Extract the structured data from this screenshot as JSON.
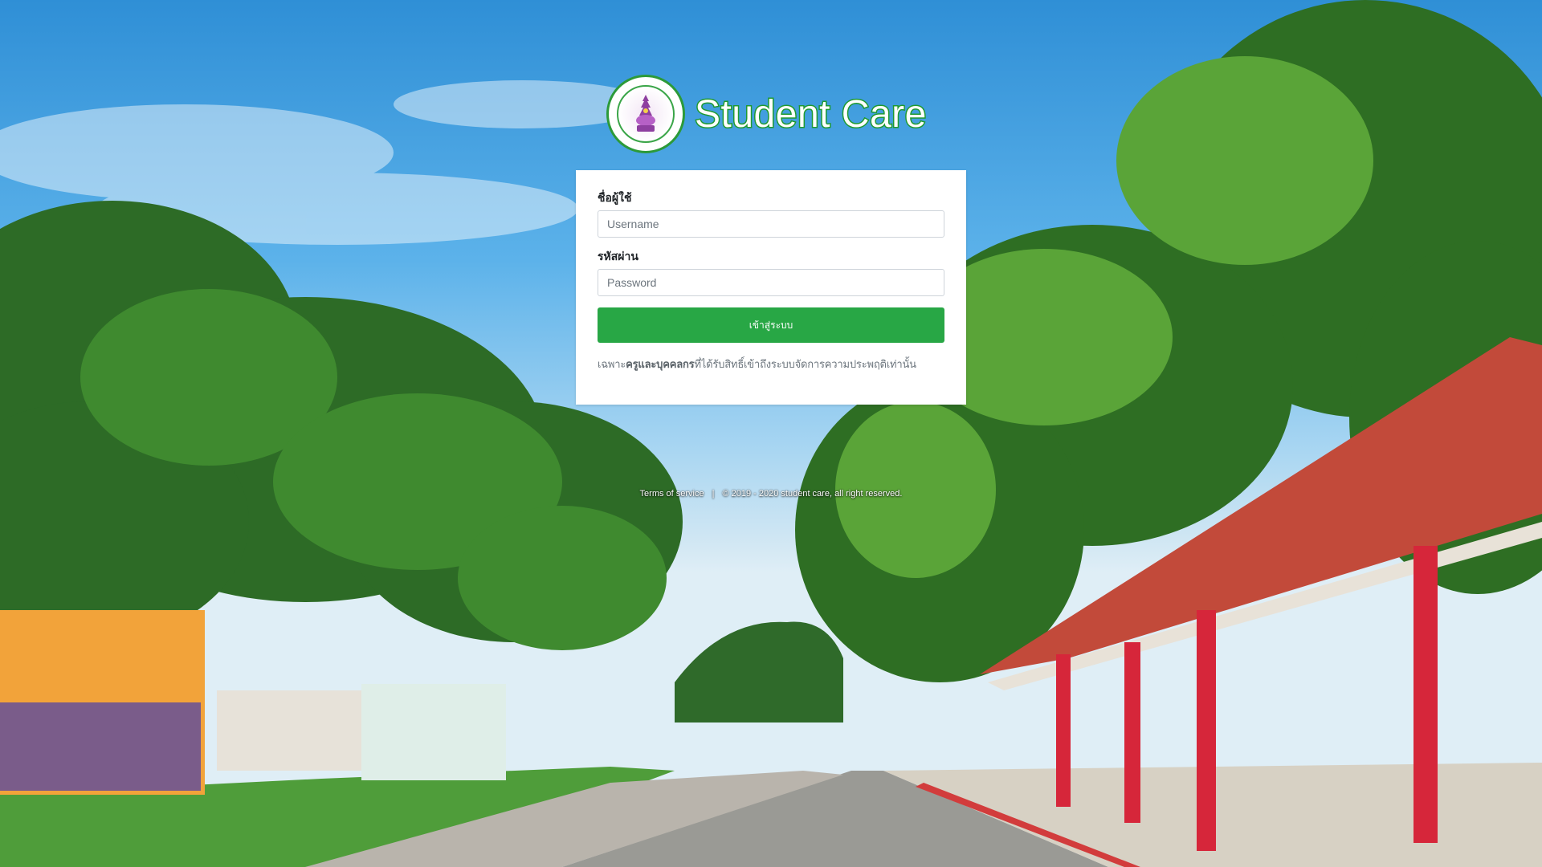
{
  "app": {
    "title": "Student Care",
    "seal_icon": "school-seal-icon"
  },
  "login_form": {
    "username_label": "ชื่อผู้ใช้",
    "username_placeholder": "Username",
    "username_value": "",
    "password_label": "รหัสผ่าน",
    "password_placeholder": "Password",
    "password_value": "",
    "submit_label": "เข้าสู่ระบบ",
    "notice_prefix": "เฉพาะ",
    "notice_emphasis": "ครูและบุคคลกร",
    "notice_suffix": "ที่ได้รับสิทธิ์เข้าถึงระบบจัดการความประพฤติเท่านั้น"
  },
  "footer": {
    "terms_label": "Terms of service",
    "separator": "|",
    "copyright": "© 2019 - 2020 student care, all right reserved."
  },
  "colors": {
    "primary_button": "#28a745",
    "brand_outline": "#1f9a30",
    "card_background": "#ffffff"
  }
}
